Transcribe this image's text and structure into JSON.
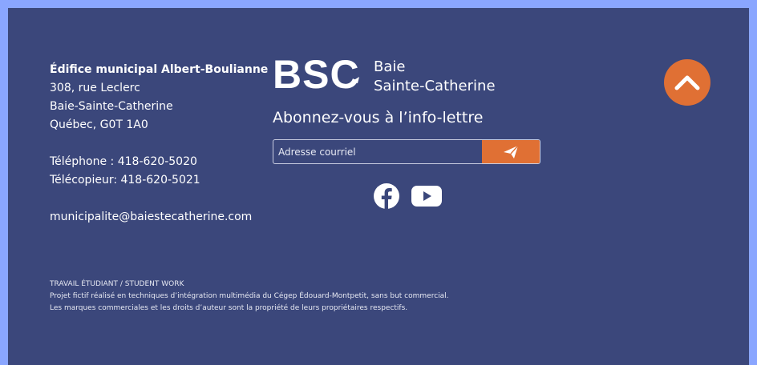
{
  "footer": {
    "address": {
      "name": "Édifice municipal Albert-Boulianne",
      "street": "308, rue Leclerc",
      "city": "Baie-Sainte-Catherine",
      "region": "Québec, G0T 1A0",
      "phone": "Téléphone : 418-620-5020",
      "fax": "Télécopieur: 418-620-5021",
      "email": "municipalite@baiestecatherine.com"
    },
    "brand": {
      "initials": "BSC",
      "line1": "Baie",
      "line2": "Sainte-Catherine"
    },
    "newsletter": {
      "title": "Abonnez-vous à l’info-lettre",
      "placeholder": "Adresse courriel",
      "submit_icon": "paper-plane-icon"
    },
    "socials": [
      {
        "icon": "facebook-icon"
      },
      {
        "icon": "youtube-icon"
      }
    ],
    "back_to_top_icon": "chevron-up-icon",
    "legal": {
      "line1": "TRAVAIL ÉTUDIANT / STUDENT WORK",
      "line2": "Projet fictif réalisé en techniques d’intégration multimédia du Cégep Édouard-Montpetit, sans but commercial.",
      "line3": "Les marques commerciales et les droits d’auteur sont la propriété de leurs propriétaires respectifs."
    }
  },
  "colors": {
    "background": "#3b477b",
    "accent": "#e07034",
    "frame": "#8aa6ff",
    "text": "#ffffff"
  }
}
